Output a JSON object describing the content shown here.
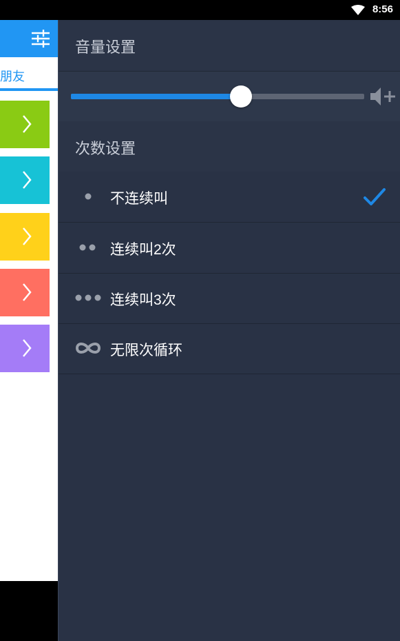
{
  "status_bar": {
    "time": "8:56",
    "wifi_icon": "wifi-icon"
  },
  "background_app": {
    "settings_icon": "sliders-icon",
    "tab_label": "朋友",
    "accent_color": "#2196f3",
    "tiles": [
      {
        "color": "#8acb14",
        "icon": "chevron-right-icon"
      },
      {
        "color": "#17c2d6",
        "icon": "chevron-right-icon"
      },
      {
        "color": "#ffd11a",
        "icon": "chevron-right-icon"
      },
      {
        "color": "#ff6f61",
        "icon": "chevron-right-icon"
      },
      {
        "color": "#a47cf7",
        "icon": "chevron-right-icon"
      }
    ]
  },
  "drawer": {
    "volume_section_title": "音量设置",
    "volume_level": 0.58,
    "volume_icon": "volume-up-icon",
    "count_section_title": "次数设置",
    "options": [
      {
        "label": "不连续叫",
        "icon": "one-dot-icon",
        "selected": true
      },
      {
        "label": "连续叫2次",
        "icon": "two-dots-icon",
        "selected": false
      },
      {
        "label": "连续叫3次",
        "icon": "three-dots-icon",
        "selected": false
      },
      {
        "label": "无限次循环",
        "icon": "infinity-icon",
        "selected": false
      }
    ],
    "accent_color": "#1e88e5"
  }
}
